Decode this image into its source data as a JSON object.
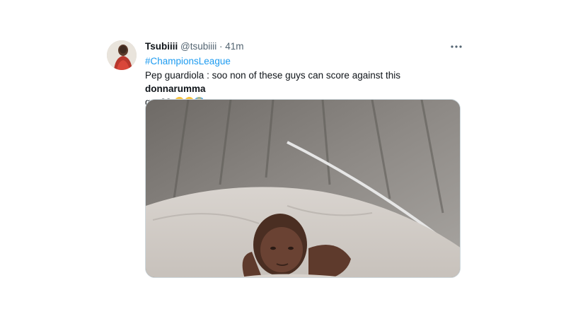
{
  "tweet": {
    "display_name": "Tsubiiii",
    "handle": "@tsubiiii",
    "separator": "·",
    "time": "41m",
    "more_icon": "ellipsis-icon",
    "hashtag": "#ChampionsLeague",
    "text_before": "Pep guardiola : soo non of these guys can score against this",
    "text_bold": "donnarumma",
    "text_after": "guy??",
    "emojis": [
      "weary-face-emoji",
      "weary-face-emoji",
      "face-with-halo-emoji"
    ],
    "media_description_icon": "photo-newborn-baby"
  },
  "colors": {
    "link": "#1d9bf0",
    "secondary_text": "#536471",
    "primary_text": "#0f1419",
    "emoji_yellow": "#f7c23b"
  }
}
